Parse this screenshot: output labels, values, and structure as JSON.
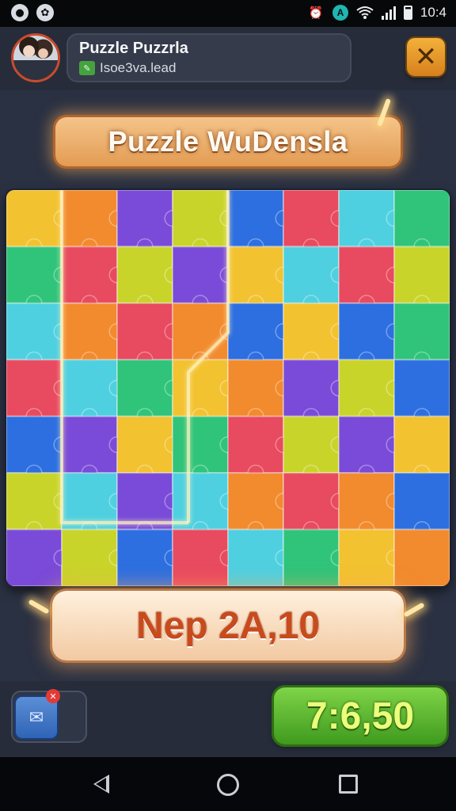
{
  "status_bar": {
    "time": "10:4",
    "left_icons": [
      "record-icon",
      "settings-cluster-icon"
    ],
    "right_icons": [
      "alarm-icon",
      "teal-app-icon",
      "wifi-icon",
      "signal-icon",
      "battery-icon"
    ]
  },
  "header": {
    "player_name": "Puzzle Puzzrla",
    "level_text": "Isoe3va.lead",
    "level_icon": "badge-icon",
    "close_icon": "close-icon"
  },
  "title": "Puzzle WuDensla",
  "moves": "Nep 2A,10",
  "score": "7:6,50",
  "bottom": {
    "message_icon": "message-icon",
    "badge_icon": "alert-badge-icon"
  },
  "colors": {
    "accent_orange": "#e39c53",
    "score_green": "#5fba30",
    "background": "#2a3142"
  },
  "board": {
    "cols": 8,
    "rows": 7,
    "palette": [
      "#f2c230",
      "#e84a5f",
      "#7a4bd8",
      "#2fc47a",
      "#2d6fe0",
      "#f28a2e",
      "#4fd0e0",
      "#c9d42a"
    ]
  }
}
